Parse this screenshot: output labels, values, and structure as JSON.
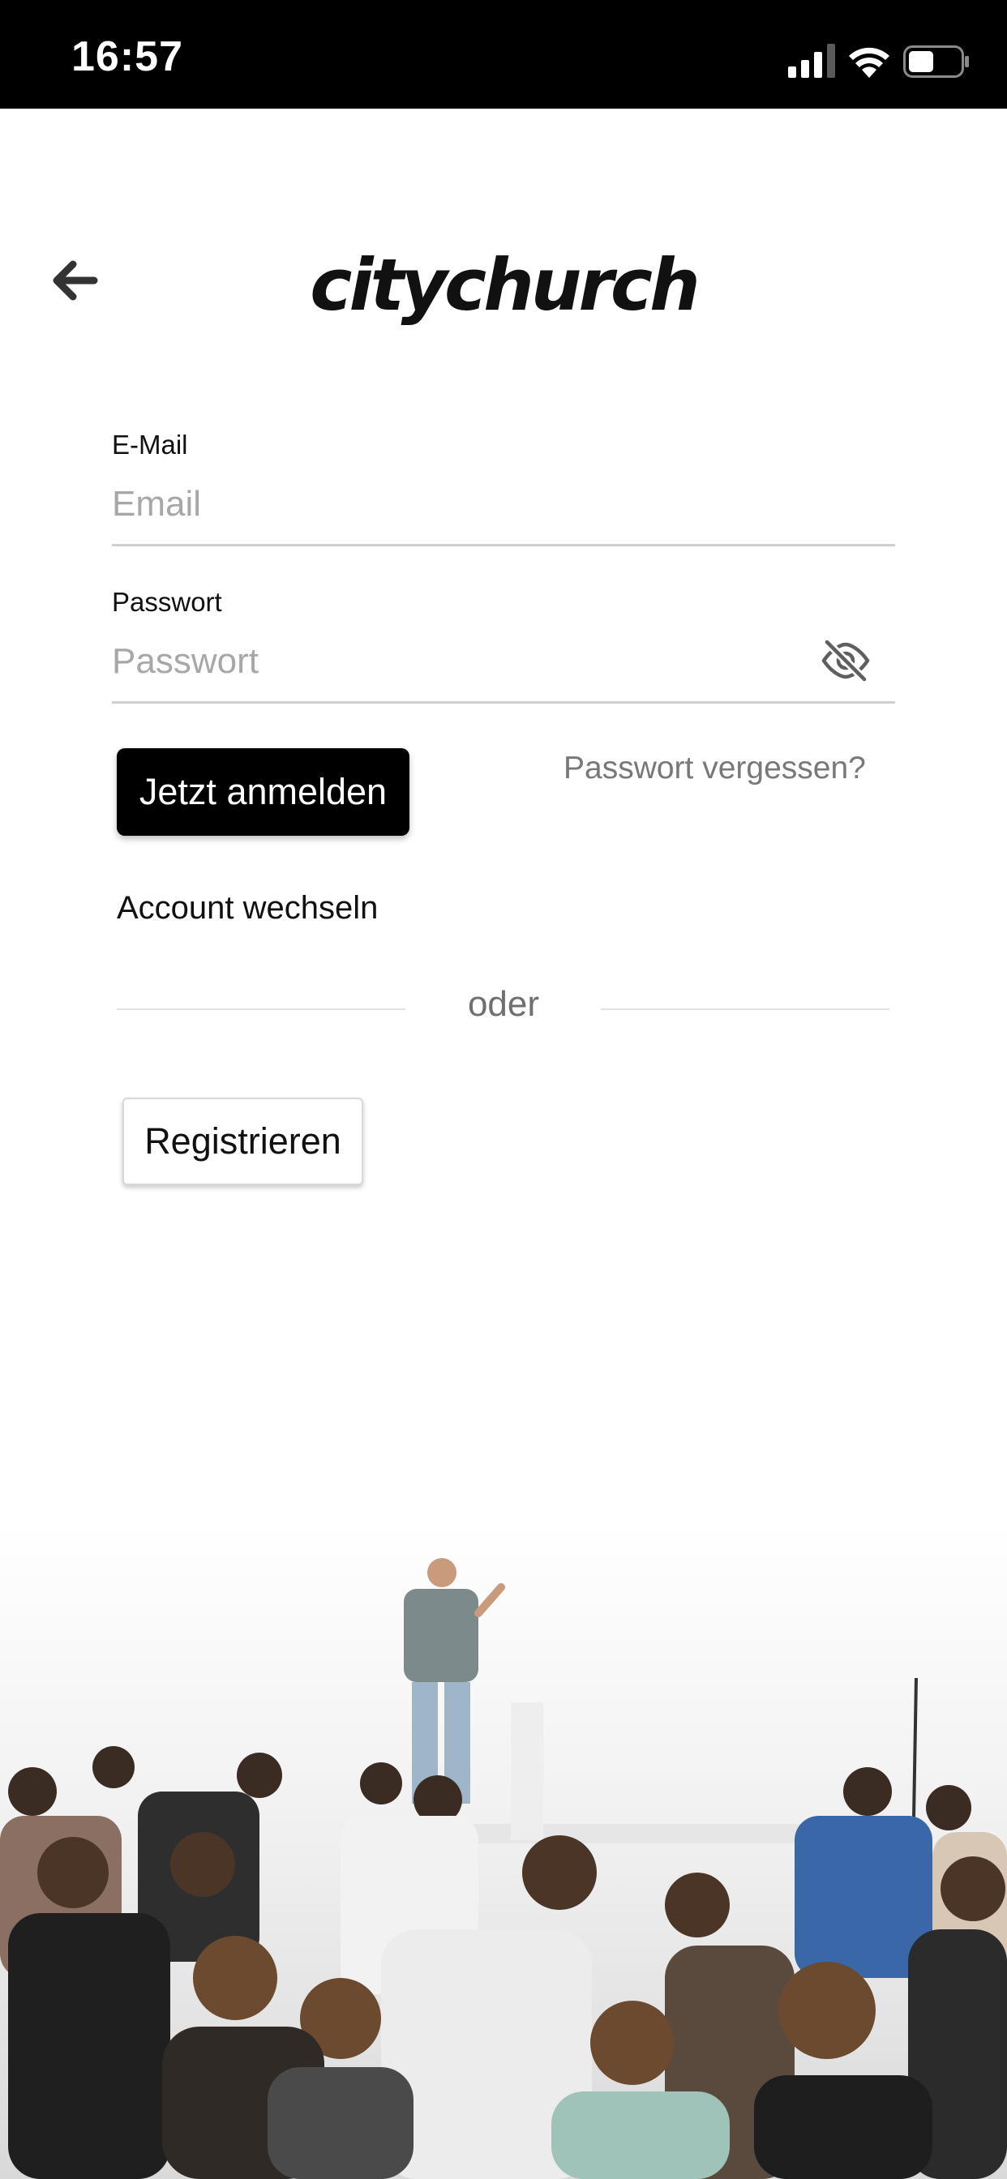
{
  "status_bar": {
    "time": "16:57"
  },
  "header": {
    "logo_text": "citychurch"
  },
  "form": {
    "email_label": "E-Mail",
    "email_placeholder": "Email",
    "email_value": "",
    "password_label": "Passwort",
    "password_placeholder": "Passwort",
    "password_value": ""
  },
  "actions": {
    "login_label": "Jetzt anmelden",
    "forgot_label": "Passwort vergessen?",
    "switch_account_label": "Account wechseln",
    "divider_label": "oder",
    "register_label": "Registrieren"
  },
  "icons": {
    "back": "arrow-left-icon",
    "eye": "eye-slash-icon",
    "signal": "cellular-signal-icon",
    "wifi": "wifi-icon",
    "battery": "battery-icon"
  },
  "colors": {
    "primary_button": "#000000",
    "placeholder": "#a7a7a7",
    "link": "#787878",
    "divider": "#e2e2e2"
  }
}
